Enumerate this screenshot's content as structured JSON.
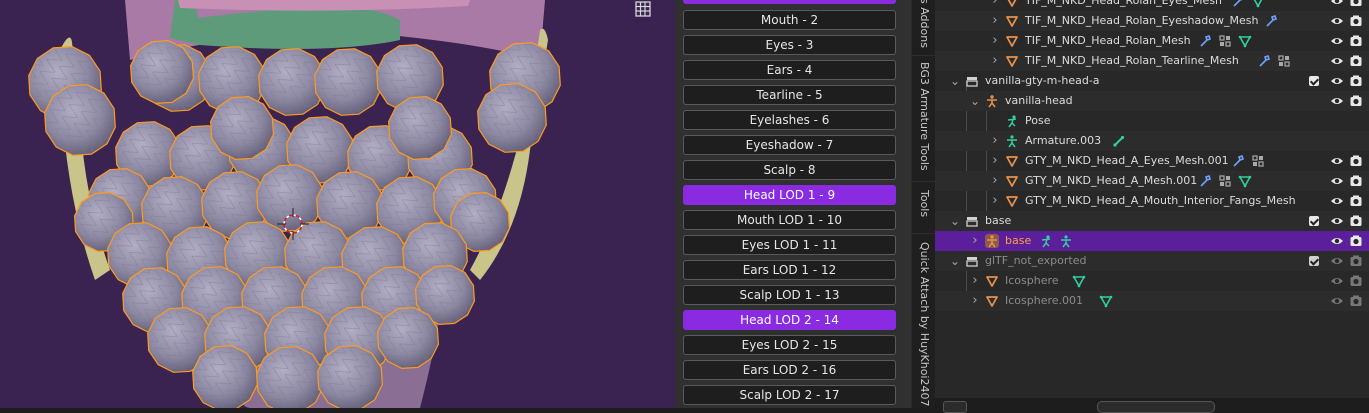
{
  "npanel": {
    "layers": [
      {
        "label": "",
        "active": true
      },
      {
        "label": "Mouth - 2",
        "active": false
      },
      {
        "label": "Eyes - 3",
        "active": false
      },
      {
        "label": "Ears - 4",
        "active": false
      },
      {
        "label": "Tearline - 5",
        "active": false
      },
      {
        "label": "Eyelashes - 6",
        "active": false
      },
      {
        "label": "Eyeshadow - 7",
        "active": false
      },
      {
        "label": "Scalp - 8",
        "active": false
      },
      {
        "label": "Head LOD 1 - 9",
        "active": true
      },
      {
        "label": "Mouth LOD 1 - 10",
        "active": false
      },
      {
        "label": "Eyes LOD 1 - 11",
        "active": false
      },
      {
        "label": "Ears LOD 1 - 12",
        "active": false
      },
      {
        "label": "Scalp LOD 1 - 13",
        "active": false
      },
      {
        "label": "Head LOD 2 - 14",
        "active": true
      },
      {
        "label": "Eyes LOD 2 - 15",
        "active": false
      },
      {
        "label": "Ears LOD 2 - 16",
        "active": false
      },
      {
        "label": "Scalp LOD 2 - 17",
        "active": false
      }
    ],
    "colors": {
      "active": "#8a2be2",
      "button": "#1e1e1e"
    }
  },
  "tabs": [
    "s Addons",
    "BG3 Armature Tools",
    "Tools",
    "Quick Attach by HuyKhoi2407"
  ],
  "outliner": {
    "rows": [
      {
        "label": "TIF_M_NKD_Head_Rolan_Eyes_Mesh",
        "icon": "mesh-icon",
        "indent": 4,
        "expander": true,
        "badges": [
          "modifier-icon",
          "mesh-data-icon"
        ],
        "visible": true
      },
      {
        "label": "TIF_M_NKD_Head_Rolan_Eyeshadow_Mesh",
        "icon": "mesh-icon",
        "indent": 4,
        "expander": true,
        "badges": [
          "modifier-icon"
        ],
        "visible": true
      },
      {
        "label": "TIF_M_NKD_Head_Rolan_Mesh",
        "icon": "mesh-icon",
        "indent": 4,
        "expander": true,
        "badges": [
          "modifier-icon",
          "vertex-groups-icon",
          "mesh-data-icon"
        ],
        "visible": true
      },
      {
        "label": "TIF_M_NKD_Head_Rolan_Tearline_Mesh",
        "icon": "mesh-icon",
        "indent": 4,
        "expander": true,
        "badges": [
          "modifier-icon",
          "vertex-groups-icon"
        ],
        "visible": true
      },
      {
        "label": "vanilla-gty-m-head-a",
        "icon": "collection-icon",
        "indent": 2,
        "expander": true,
        "open": true,
        "checkbox": true,
        "visible": true
      },
      {
        "label": "vanilla-head",
        "icon": "armature-object-icon",
        "indent": 3,
        "expander": true,
        "open": true,
        "visible": true
      },
      {
        "label": "Pose",
        "icon": "pose-icon",
        "indent": 4,
        "expander": false,
        "badges": [],
        "visible": false
      },
      {
        "label": "Armature.003",
        "icon": "armature-data-icon",
        "indent": 4,
        "expander": true,
        "badges": [
          "bone-icon"
        ],
        "visible": false
      },
      {
        "label": "GTY_M_NKD_Head_A_Eyes_Mesh.001",
        "icon": "mesh-icon",
        "indent": 4,
        "expander": true,
        "badges": [
          "modifier-icon",
          "vertex-groups-icon"
        ],
        "visible": true
      },
      {
        "label": "GTY_M_NKD_Head_A_Mesh.001",
        "icon": "mesh-icon",
        "indent": 4,
        "expander": true,
        "badges": [
          "modifier-icon",
          "vertex-groups-icon",
          "mesh-data-icon"
        ],
        "visible": true
      },
      {
        "label": "GTY_M_NKD_Head_A_Mouth_Interior_Fangs_Mesh",
        "icon": "mesh-icon",
        "indent": 4,
        "expander": true,
        "badges": [],
        "visible": true
      },
      {
        "label": "base",
        "icon": "collection-icon",
        "indent": 2,
        "expander": true,
        "open": true,
        "checkbox": true,
        "visible": true
      },
      {
        "label": "base",
        "icon": "armature-object-icon",
        "indent": 3,
        "expander": true,
        "selected": true,
        "badges": [
          "pose-icon",
          "armature-data-icon"
        ],
        "visible": true
      },
      {
        "label": "glTF_not_exported",
        "icon": "collection-icon",
        "indent": 2,
        "expander": true,
        "open": true,
        "checkbox": true,
        "dim": true,
        "visible": true
      },
      {
        "label": "Icosphere",
        "icon": "mesh-icon",
        "indent": 3,
        "expander": true,
        "dim": true,
        "badges": [
          "mesh-data-icon"
        ],
        "visible": true
      },
      {
        "label": "Icosphere.001",
        "icon": "mesh-icon",
        "indent": 3,
        "expander": true,
        "dim": true,
        "badges": [
          "mesh-data-icon"
        ],
        "visible": true
      }
    ],
    "colors": {
      "selected_row": "#5b1f9c",
      "mesh": "#e8904a",
      "data": "#30d0a0",
      "modifier": "#6fa0ff"
    }
  },
  "viewport": {
    "colors": {
      "background": "#3a2350",
      "sphere": "#8d88a2",
      "outline": "#ff9a1f",
      "skin": "#a97aa6",
      "scalp": "#5d9b7a",
      "ears": "#c9c48a"
    }
  }
}
